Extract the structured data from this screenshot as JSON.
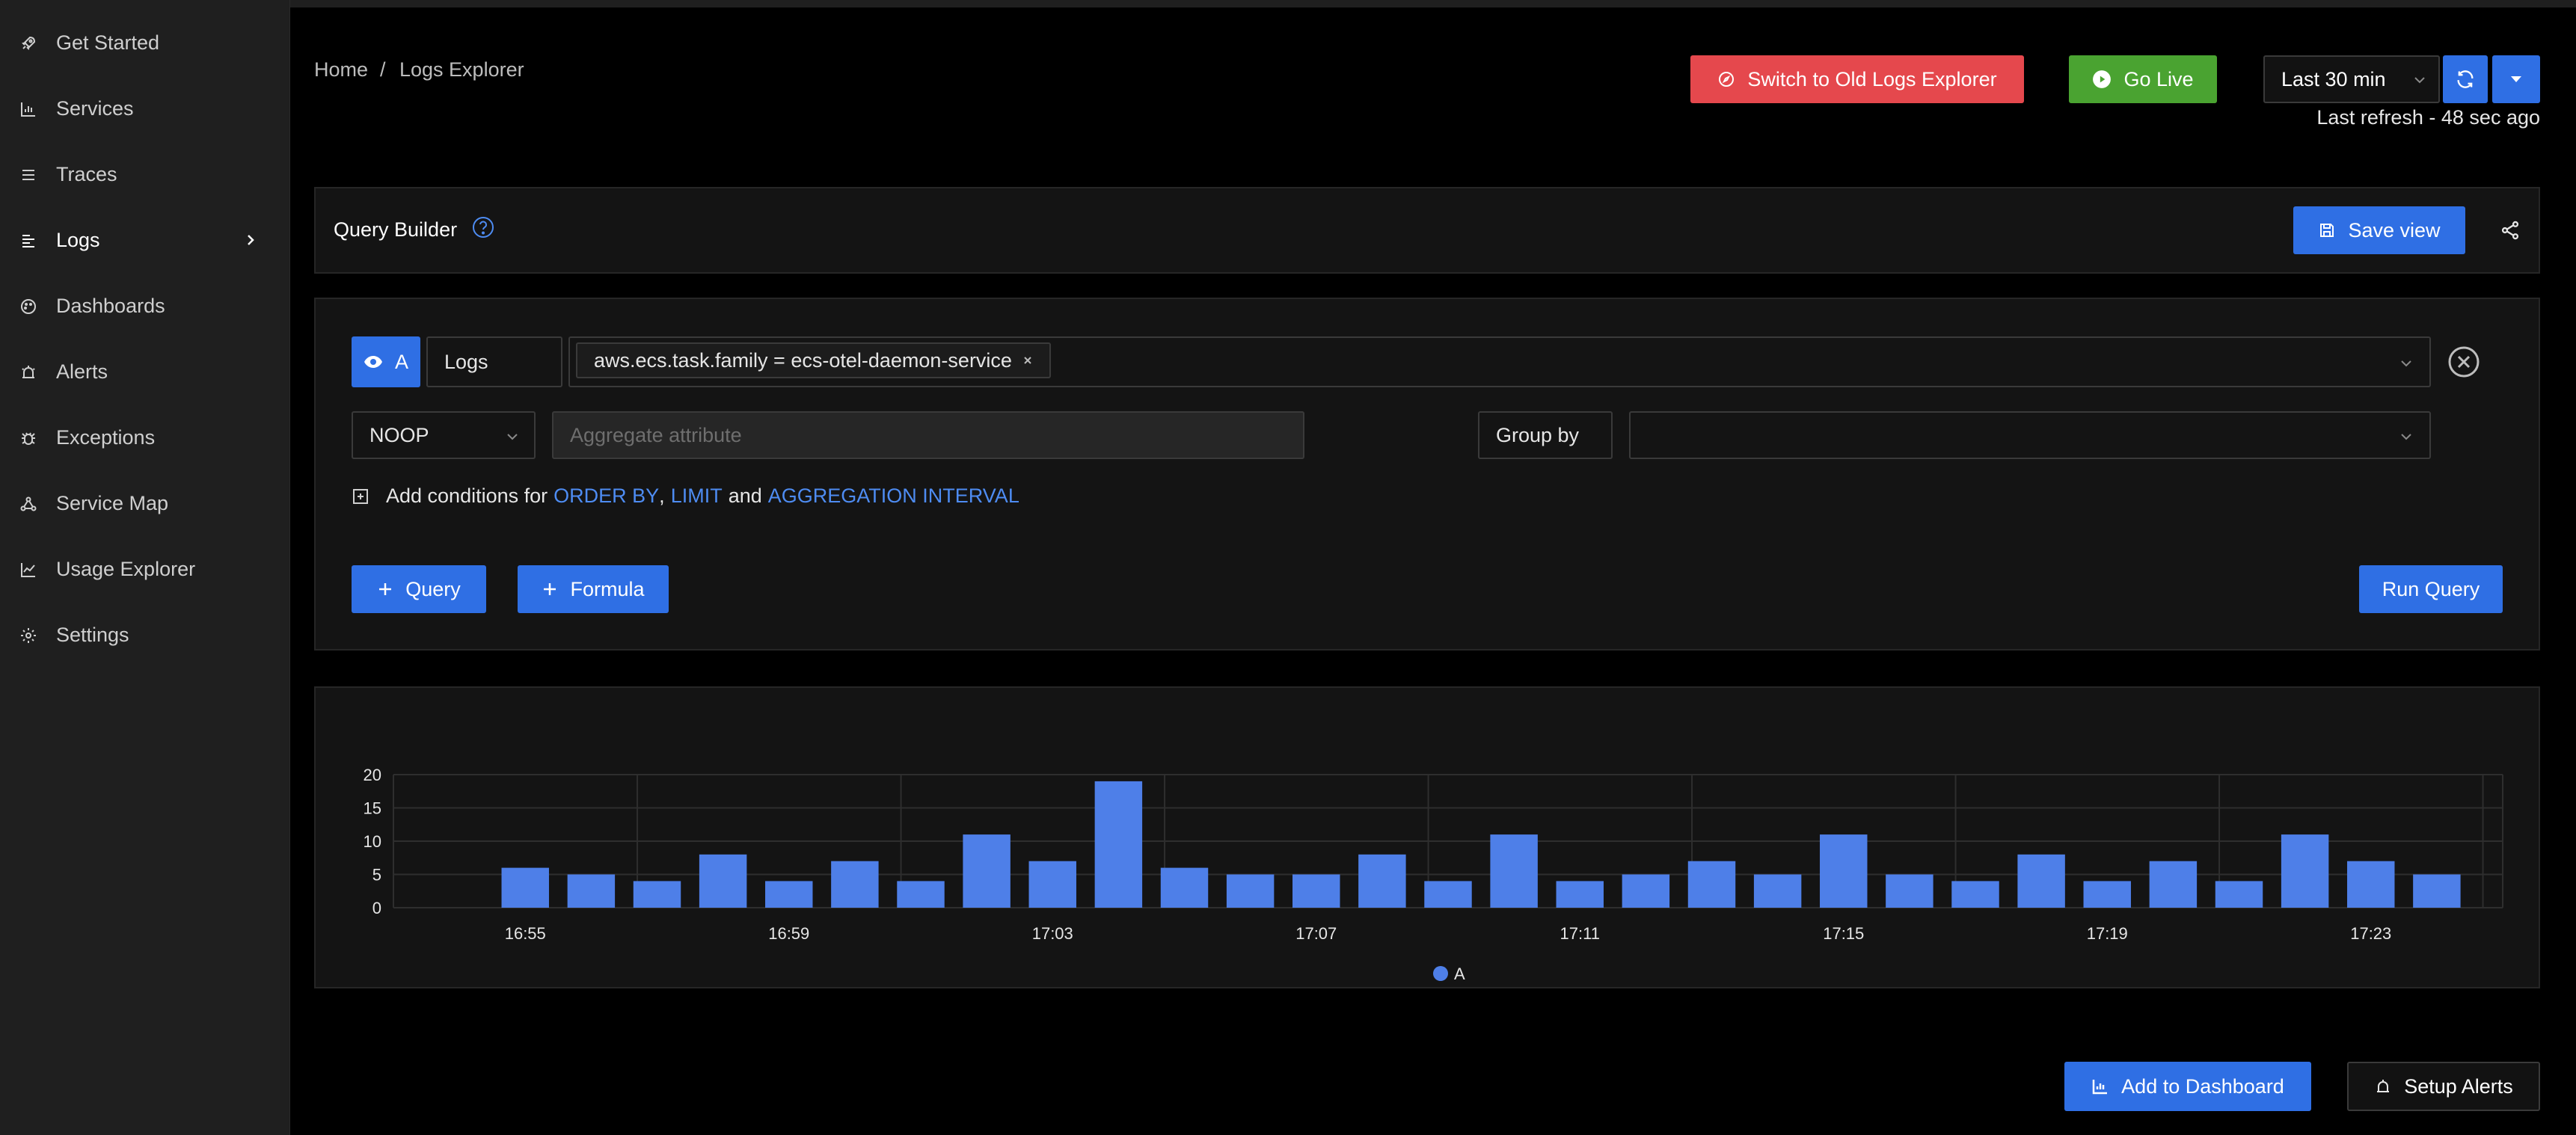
{
  "sidebar": {
    "items": [
      {
        "label": "Get Started",
        "icon": "rocket-icon"
      },
      {
        "label": "Services",
        "icon": "bar-chart-icon"
      },
      {
        "label": "Traces",
        "icon": "list-icon"
      },
      {
        "label": "Logs",
        "icon": "logs-icon"
      },
      {
        "label": "Dashboards",
        "icon": "dashboard-icon"
      },
      {
        "label": "Alerts",
        "icon": "alarm-icon"
      },
      {
        "label": "Exceptions",
        "icon": "bug-icon"
      },
      {
        "label": "Service Map",
        "icon": "network-icon"
      },
      {
        "label": "Usage Explorer",
        "icon": "line-chart-icon"
      },
      {
        "label": "Settings",
        "icon": "gear-icon"
      }
    ],
    "active_index": 3
  },
  "breadcrumb": {
    "home": "Home",
    "separator": "/",
    "current": "Logs Explorer"
  },
  "header": {
    "switch_label": "Switch to Old Logs Explorer",
    "go_live_label": "Go Live",
    "time_range": "Last 30 min",
    "last_refresh": "Last refresh - 48 sec ago"
  },
  "query_builder": {
    "title": "Query Builder",
    "save_view_label": "Save view"
  },
  "query": {
    "name": "A",
    "data_source": "Logs",
    "filter_chip": "aws.ecs.task.family = ecs-otel-daemon-service",
    "aggregate_operator": "NOOP",
    "aggregate_attribute_placeholder": "Aggregate attribute",
    "group_by_label": "Group by",
    "conditions_prefix": "Add conditions for",
    "order_by": "ORDER BY",
    "comma": ",",
    "limit": "LIMIT",
    "and": "and",
    "aggregation_interval": "AGGREGATION INTERVAL",
    "add_query_label": "Query",
    "add_formula_label": "Formula",
    "run_query_label": "Run Query"
  },
  "footer": {
    "add_dashboard_label": "Add to Dashboard",
    "setup_alerts_label": "Setup Alerts"
  },
  "colors": {
    "accent": "#2f6fe4",
    "danger": "#e5484d",
    "success": "#4aa331",
    "bar": "#4e7fe8"
  },
  "chart_data": {
    "type": "bar",
    "x": [
      "16:54",
      "16:55",
      "16:56",
      "16:57",
      "16:58",
      "16:59",
      "17:00",
      "17:01",
      "17:02",
      "17:03",
      "17:04",
      "17:05",
      "17:06",
      "17:07",
      "17:08",
      "17:09",
      "17:10",
      "17:11",
      "17:12",
      "17:13",
      "17:14",
      "17:15",
      "17:16",
      "17:17",
      "17:18",
      "17:19",
      "17:20",
      "17:21",
      "17:22",
      "17:23",
      "17:24"
    ],
    "xtick_labels": [
      "16:55",
      "16:59",
      "17:03",
      "17:07",
      "17:11",
      "17:15",
      "17:19",
      "17:23"
    ],
    "series": [
      {
        "name": "A",
        "values": [
          6,
          5,
          4,
          8,
          4,
          7,
          4,
          11,
          7,
          19,
          6,
          5,
          5,
          8,
          4,
          11,
          4,
          5,
          7,
          5,
          11,
          5,
          4,
          8,
          4,
          7,
          4,
          11,
          7,
          5
        ]
      }
    ],
    "yticks": [
      0,
      5,
      10,
      15,
      20
    ],
    "ylim": [
      0,
      20
    ],
    "grid": true,
    "legend": "bottom-center"
  }
}
